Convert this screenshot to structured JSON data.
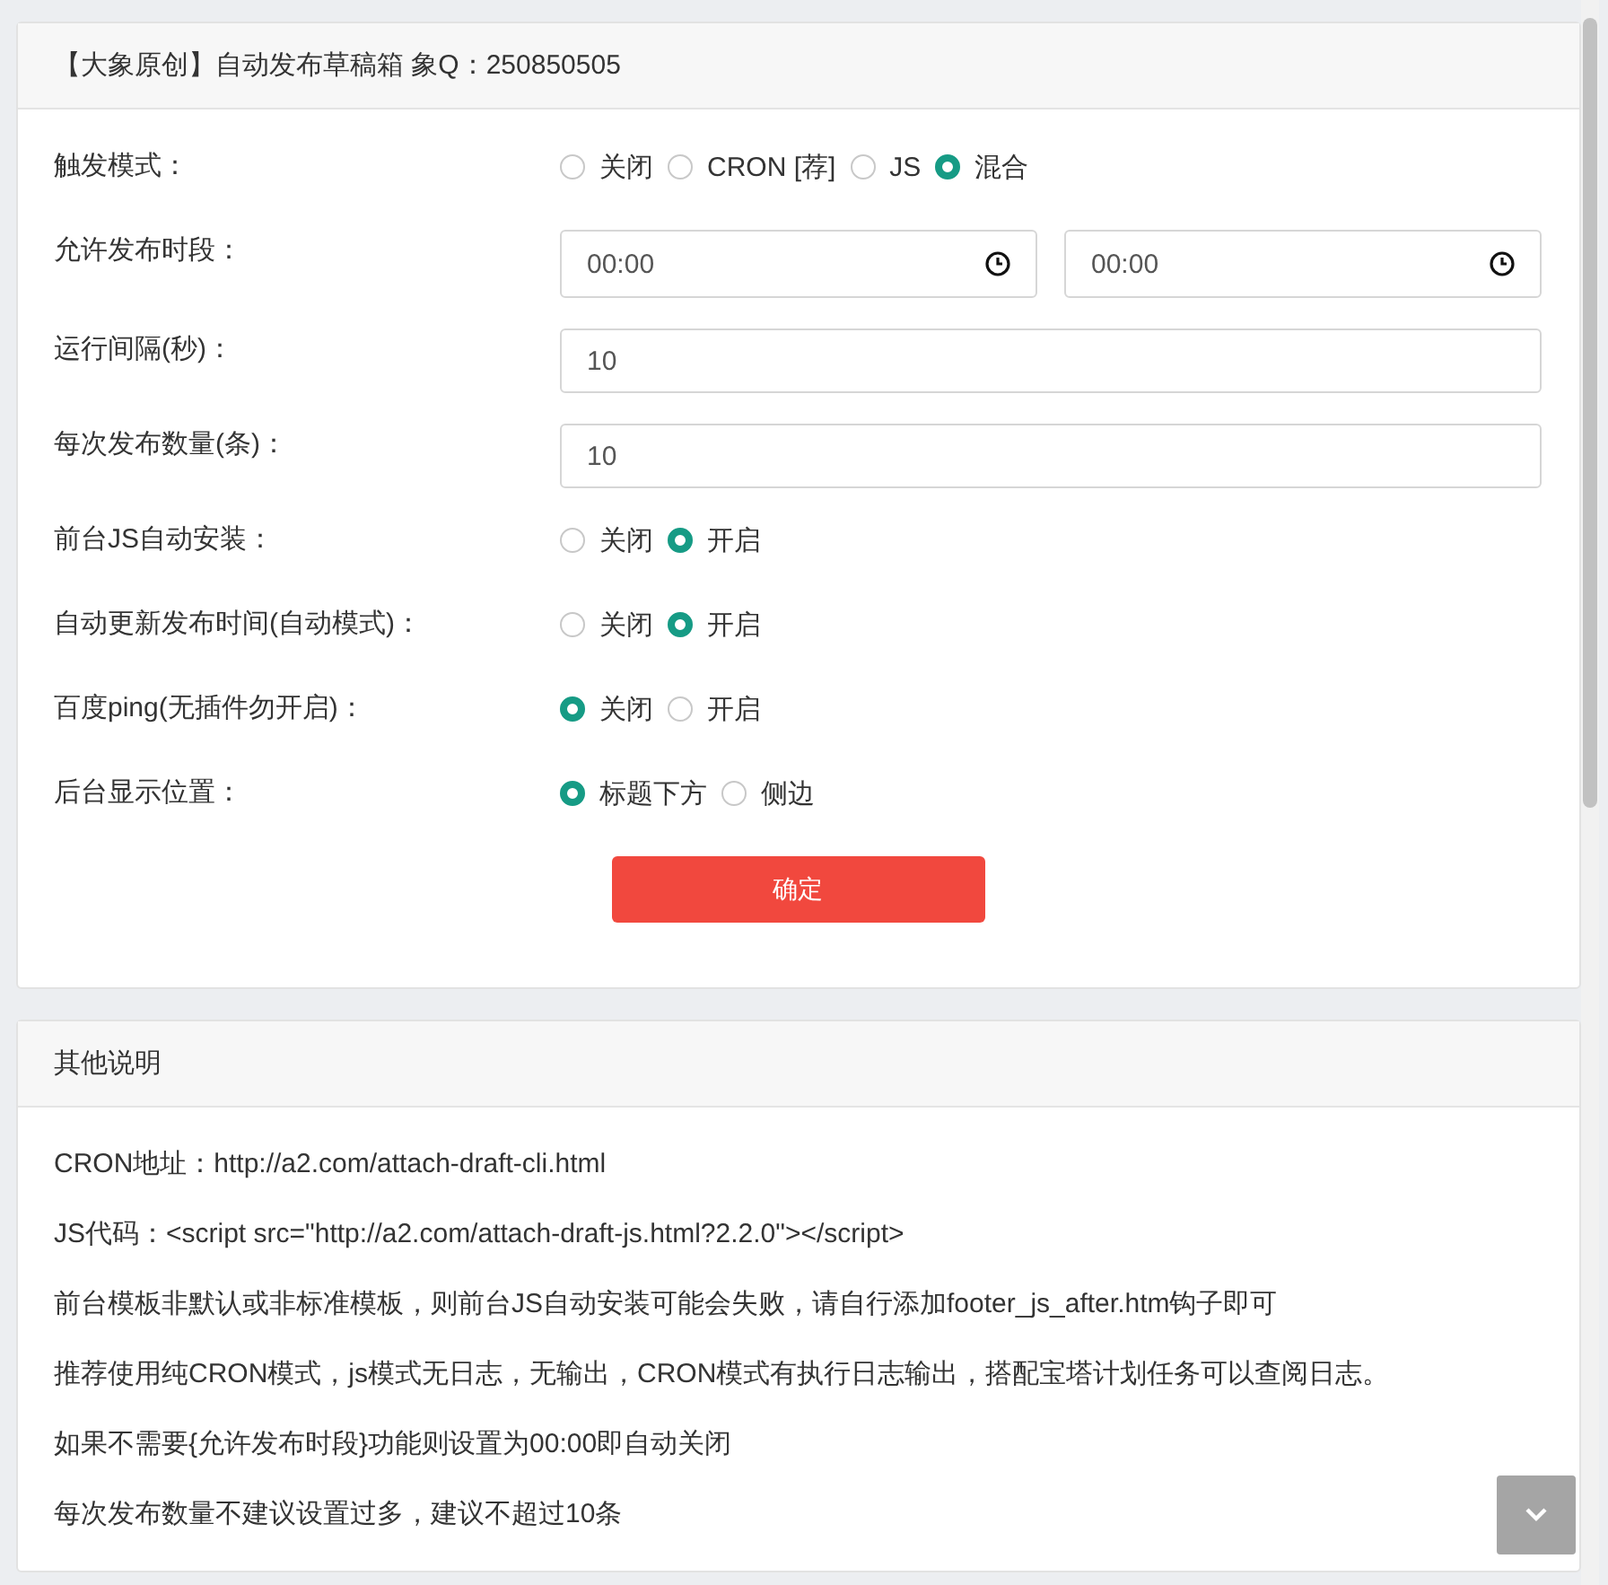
{
  "settings_card": {
    "title": "【大象原创】自动发布草稿箱 象Q：250850505",
    "rows": [
      {
        "kind": "radio",
        "label": "触发模式：",
        "options": [
          {
            "label": "关闭",
            "selected": false
          },
          {
            "label": "CRON [荐]",
            "selected": false
          },
          {
            "label": "JS",
            "selected": false
          },
          {
            "label": "混合",
            "selected": true
          }
        ]
      },
      {
        "kind": "time",
        "label": "允许发布时段：",
        "values": [
          "00:00",
          "00:00"
        ]
      },
      {
        "kind": "text",
        "label": "运行间隔(秒)：",
        "value": "10"
      },
      {
        "kind": "text",
        "label": "每次发布数量(条)：",
        "value": "10"
      },
      {
        "kind": "radio",
        "label": "前台JS自动安装：",
        "options": [
          {
            "label": "关闭",
            "selected": false
          },
          {
            "label": "开启",
            "selected": true
          }
        ]
      },
      {
        "kind": "radio",
        "label": "自动更新发布时间(自动模式)：",
        "options": [
          {
            "label": "关闭",
            "selected": false
          },
          {
            "label": "开启",
            "selected": true
          }
        ]
      },
      {
        "kind": "radio",
        "label": "百度ping(无插件勿开启)：",
        "options": [
          {
            "label": "关闭",
            "selected": true
          },
          {
            "label": "开启",
            "selected": false
          }
        ]
      },
      {
        "kind": "radio",
        "label": "后台显示位置：",
        "options": [
          {
            "label": "标题下方",
            "selected": true
          },
          {
            "label": "侧边",
            "selected": false
          }
        ]
      }
    ],
    "submit_button": "确定"
  },
  "notes_card": {
    "title": "其他说明",
    "lines": [
      "CRON地址：http://a2.com/attach-draft-cli.html",
      "JS代码：<script src=\"http://a2.com/attach-draft-js.html?2.2.0\"></script>",
      "前台模板非默认或非标准模板，则前台JS自动安装可能会失败，请自行添加footer_js_after.htm钩子即可",
      "推荐使用纯CRON模式，js模式无日志，无输出，CRON模式有执行日志输出，搭配宝塔计划任务可以查阅日志。",
      "如果不需要{允许发布时段}功能则设置为00:00即自动关闭",
      "每次发布数量不建议设置过多，建议不超过10条"
    ]
  }
}
